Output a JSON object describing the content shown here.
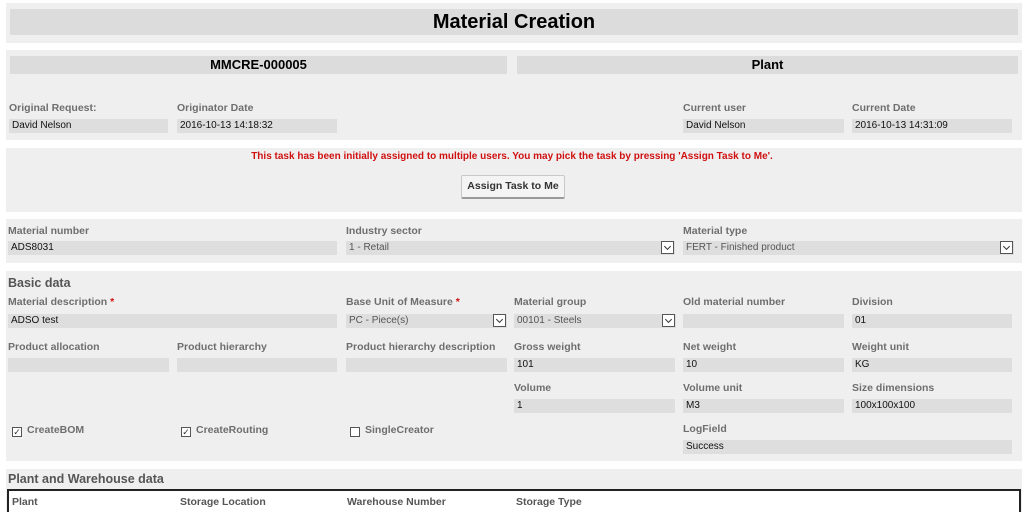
{
  "title": "Material Creation",
  "header": {
    "request_id": "MMCRE-000005",
    "plant_label": "Plant",
    "original_request_label": "Original Request:",
    "original_request_value": "David Nelson",
    "originator_date_label": "Originator Date",
    "originator_date_value": "2016-10-13 14:18:32",
    "current_user_label": "Current user",
    "current_user_value": "David Nelson",
    "current_date_label": "Current Date",
    "current_date_value": "2016-10-13 14:31:09"
  },
  "assignment": {
    "notice": "This task has been initially assigned to multiple users. You may pick the task by pressing 'Assign Task to Me'.",
    "button_label": "Assign Task to Me"
  },
  "material": {
    "number_label": "Material number",
    "number_value": "ADS8031",
    "industry_label": "Industry sector",
    "industry_value": "1 - Retail",
    "type_label": "Material type",
    "type_value": "FERT - Finished product"
  },
  "basic": {
    "section_title": "Basic data",
    "description_label": "Material description",
    "description_value": "ADSO test",
    "required_mark": "*",
    "uom_label": "Base Unit of Measure",
    "uom_value": "PC - Piece(s)",
    "group_label": "Material group",
    "group_value": "00101 - Steels",
    "old_number_label": "Old material number",
    "old_number_value": "",
    "division_label": "Division",
    "division_value": "01",
    "product_allocation_label": "Product allocation",
    "product_allocation_value": "",
    "product_hierarchy_label": "Product hierarchy",
    "product_hierarchy_value": "",
    "hierarchy_desc_label": "Product hierarchy description",
    "hierarchy_desc_value": "",
    "gross_weight_label": "Gross weight",
    "gross_weight_value": "101",
    "net_weight_label": "Net weight",
    "net_weight_value": "10",
    "weight_unit_label": "Weight unit",
    "weight_unit_value": "KG",
    "volume_label": "Volume",
    "volume_value": "1",
    "volume_unit_label": "Volume unit",
    "volume_unit_value": "M3",
    "size_label": "Size dimensions",
    "size_value": "100x100x100",
    "create_bom_label": "CreateBOM",
    "create_routing_label": "CreateRouting",
    "single_creator_label": "SingleCreator",
    "check_mark": "✓",
    "logfield_label": "LogField",
    "logfield_value": "Success"
  },
  "plant_section": {
    "title": "Plant and Warehouse data",
    "columns": [
      "Plant",
      "Storage Location",
      "Warehouse Number",
      "Storage Type"
    ]
  }
}
